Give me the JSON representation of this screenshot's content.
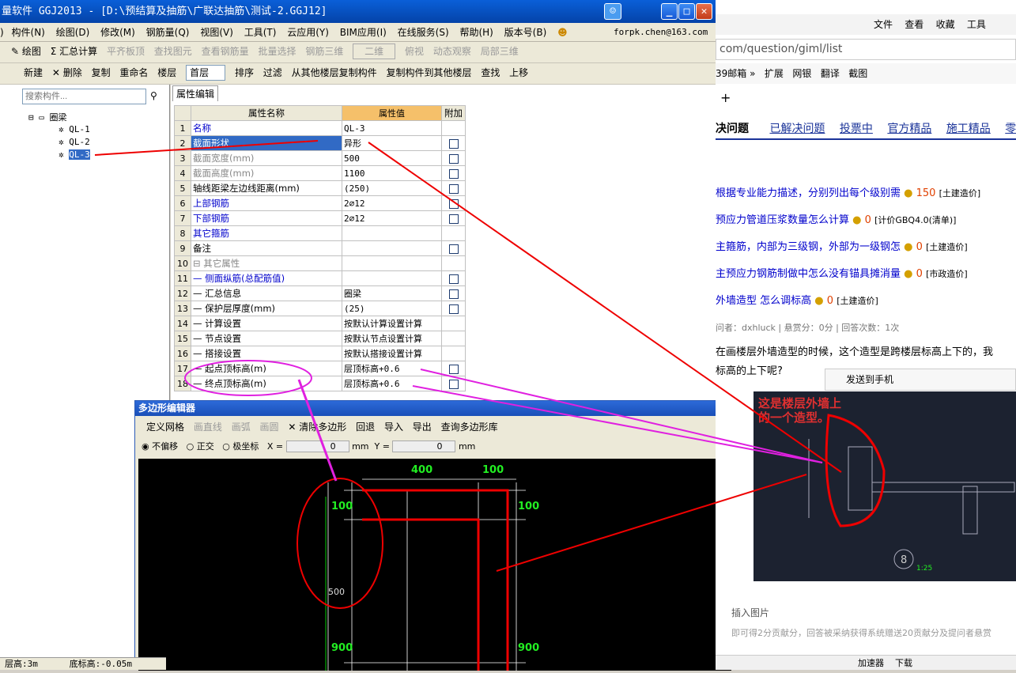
{
  "app": {
    "title": "量软件 GGJ2013 - [D:\\预结算及抽筋\\广联达抽筋\\测试-2.GGJ12]",
    "user": "forpk.chen@163.com"
  },
  "menu": [
    "构件(N)",
    "绘图(D)",
    "修改(M)",
    "钢筋量(Q)",
    "视图(V)",
    "工具(T)",
    "云应用(Y)",
    "BIM应用(I)",
    "在线服务(S)",
    "帮助(H)",
    "版本号(B)"
  ],
  "toolbar1": {
    "draw": "绘图",
    "sum": "Σ 汇总计算",
    "flat": "平齐板顶",
    "find": "查找图元",
    "view_rebar": "查看钢筋量",
    "batch": "批量选择",
    "rebar3d": "钢筋三维",
    "mode": "二维",
    "top_view": "俯视",
    "dyn": "动态观察",
    "local3d": "局部三维"
  },
  "toolbar2": {
    "new": "新建",
    "delete": "删除",
    "copy": "复制",
    "rename": "重命名",
    "floor_label": "楼层",
    "floor_value": "首层",
    "sort": "排序",
    "filter": "过滤",
    "copy_from": "从其他楼层复制构件",
    "copy_to": "复制构件到其他楼层",
    "find": "查找",
    "up": "上移"
  },
  "left": {
    "search_placeholder": "搜索构件...",
    "root": "圈梁",
    "items": [
      "QL-1",
      "QL-2",
      "QL-3"
    ]
  },
  "props": {
    "tab": "属性编辑",
    "headers": [
      "属性名称",
      "属性值",
      "附加"
    ],
    "rows": [
      {
        "n": "1",
        "name": "名称",
        "value": "QL-3",
        "cb": false,
        "style": "blue"
      },
      {
        "n": "2",
        "name": "截面形状",
        "value": "异形",
        "cb": true,
        "style": "sel"
      },
      {
        "n": "3",
        "name": "截面宽度(mm)",
        "value": "500",
        "cb": true,
        "style": "gray"
      },
      {
        "n": "4",
        "name": "截面高度(mm)",
        "value": "1100",
        "cb": true,
        "style": "gray"
      },
      {
        "n": "5",
        "name": "轴线距梁左边线距离(mm)",
        "value": "(250)",
        "cb": true,
        "style": ""
      },
      {
        "n": "6",
        "name": "上部钢筋",
        "value": "2⌀12",
        "cb": true,
        "style": "blue"
      },
      {
        "n": "7",
        "name": "下部钢筋",
        "value": "2⌀12",
        "cb": true,
        "style": "blue"
      },
      {
        "n": "8",
        "name": "其它箍筋",
        "value": "",
        "cb": false,
        "style": "blue"
      },
      {
        "n": "9",
        "name": "备注",
        "value": "",
        "cb": true,
        "style": ""
      },
      {
        "n": "10",
        "name": "⊟ 其它属性",
        "value": "",
        "cb": false,
        "style": "gray"
      },
      {
        "n": "11",
        "name": "— 侧面纵筋(总配筋值)",
        "value": "",
        "cb": true,
        "style": "blue"
      },
      {
        "n": "12",
        "name": "— 汇总信息",
        "value": "圈梁",
        "cb": true,
        "style": ""
      },
      {
        "n": "13",
        "name": "— 保护层厚度(mm)",
        "value": "(25)",
        "cb": true,
        "style": ""
      },
      {
        "n": "14",
        "name": "— 计算设置",
        "value": "按默认计算设置计算",
        "cb": false,
        "style": ""
      },
      {
        "n": "15",
        "name": "— 节点设置",
        "value": "按默认节点设置计算",
        "cb": false,
        "style": ""
      },
      {
        "n": "16",
        "name": "— 搭接设置",
        "value": "按默认搭接设置计算",
        "cb": false,
        "style": ""
      },
      {
        "n": "17",
        "name": "— 起点顶标高(m)",
        "value": "层顶标高+0.6",
        "cb": true,
        "style": ""
      },
      {
        "n": "18",
        "name": "— 终点顶标高(m)",
        "value": "层顶标高+0.6",
        "cb": true,
        "style": ""
      }
    ]
  },
  "poly": {
    "title": "多边形编辑器",
    "tools": [
      "定义网格",
      "画直线",
      "画弧",
      "画圆",
      "清除多边形",
      "回退",
      "导入",
      "导出",
      "查询多边形库"
    ],
    "coords": [
      "不偏移",
      "正交",
      "极坐标"
    ],
    "x_label": "X =",
    "x_value": "0",
    "y_label": "Y =",
    "y_value": "0",
    "unit": "mm",
    "dims": {
      "top1": "400",
      "top2": "100",
      "right1": "100",
      "left1": "100",
      "left_mid": "500",
      "left_bot": "900",
      "right_bot": "900"
    }
  },
  "browser": {
    "url": "com/question/giml/list",
    "menu": [
      "文件",
      "查看",
      "收藏",
      "工具"
    ],
    "bar": [
      "39邮箱",
      "扩展",
      "网银",
      "翻译",
      "截图"
    ],
    "tabs": [
      "决问题",
      "已解决问题",
      "投票中",
      "官方精品",
      "施工精品",
      "零回"
    ],
    "questions": [
      {
        "t": "根据专业能力描述，分别列出每个级别需",
        "score": "150",
        "tag": "[土建造价]"
      },
      {
        "t": "预应力管道压浆数量怎么计算",
        "score": "0",
        "tag": "[计价GBQ4.0(清单)]"
      },
      {
        "t": "主箍筋，内部为三级钢，外部为一级钢怎",
        "score": "0",
        "tag": "[土建造价]"
      },
      {
        "t": "主预应力钢筋制做中怎么没有锚具摊消量",
        "score": "0",
        "tag": "[市政造价]"
      },
      {
        "t": "外墙造型 怎么调标高",
        "score": "0",
        "tag": "[土建造价]"
      }
    ],
    "asker": "问者：dxhluck | 悬赏分：0分 | 回答次数：1次",
    "body": "在画楼层外墙造型的时候，这个造型是跨楼层标高上下的，我",
    "body2": "标高的上下呢?",
    "send": "发送到手机",
    "img_note": "这是楼层外墙上的一个造型。",
    "img_num": "8",
    "img_scale": "1:25",
    "insert": "插入图片",
    "reward": "即可得2分贡献分，回答被采纳获得系统赠送20贡献分及提问者悬赏",
    "status": [
      "加速器",
      "下载"
    ]
  },
  "status": {
    "floor_h": "层高:3m",
    "bottom": "底标高:-0.05m"
  }
}
